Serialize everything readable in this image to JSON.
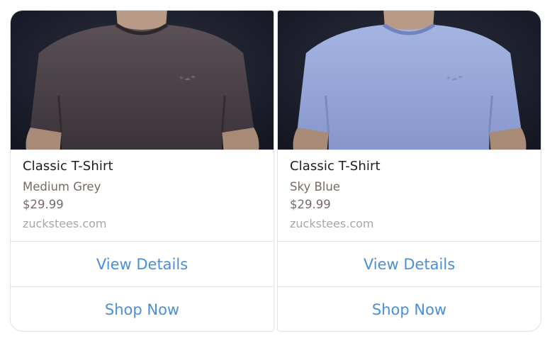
{
  "cards": [
    {
      "title": "Classic T-Shirt",
      "variant": "Medium Grey",
      "price": "$29.99",
      "domain": "zuckstees.com",
      "actions": [
        "View Details",
        "Shop Now"
      ],
      "shirt_color": "#4a4247"
    },
    {
      "title": "Classic T-Shirt",
      "variant": "Sky Blue",
      "price": "$29.99",
      "domain": "zuckstees.com",
      "actions": [
        "View Details",
        "Shop Now"
      ],
      "shirt_color": "#93a5d8"
    }
  ],
  "colors": {
    "action_text": "#4a8fde",
    "title_text": "#1d1d1f",
    "meta_text": "#7a6a66",
    "domain_text": "#a7a7ad"
  }
}
